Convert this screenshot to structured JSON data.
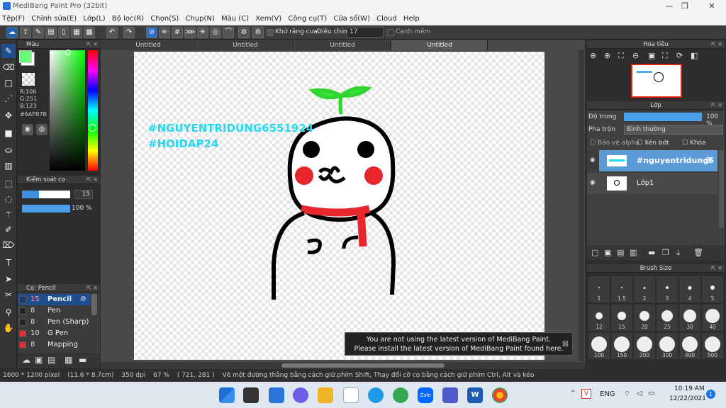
{
  "window": {
    "title": "MediBang Paint Pro (32bit)"
  },
  "menu": [
    "Tệp(F)",
    "Chỉnh sửa(E)",
    "Lớp(L)",
    "Bộ lọc(R)",
    "Chọn(S)",
    "Chụp(N)",
    "Màu (C)",
    "Xem(V)",
    "Công cụ(T)",
    "Cửa sổ(W)",
    "Cloud",
    "Help"
  ],
  "toolbar": {
    "antialias_label": "Khử răng cưa",
    "correction_label": "Điều chỉnh",
    "correction_value": "17",
    "snap_label": "Cạnh mềm"
  },
  "tabs": [
    "Untitled",
    "Untitled",
    "Untitled",
    "Untitled"
  ],
  "color_panel": {
    "title": "Màu",
    "r": "R:106",
    "g": "G:251",
    "b": "B:123",
    "hex": "#6AFB7B",
    "fg_color": "#6afb7b"
  },
  "brush_control": {
    "title": "Kiểm soát cọ",
    "size": "15",
    "opacity": "100 %"
  },
  "brush_list": {
    "title": "Cọ: Pencil",
    "items": [
      {
        "size": "15",
        "name": "Pencil",
        "color": "#1a3b6b"
      },
      {
        "size": "8",
        "name": "Pen",
        "color": "#222222"
      },
      {
        "size": "8",
        "name": "Pen (Sharp)",
        "color": "#222222"
      },
      {
        "size": "10",
        "name": "G Pen",
        "color": "#e03030"
      },
      {
        "size": "8",
        "name": "Mapping Pen",
        "color": "#e03030"
      }
    ]
  },
  "navigator": {
    "title": "Hoa tiêu"
  },
  "layer_panel": {
    "title": "Lớp",
    "opacity_label": "Độ trong",
    "opacity_value": "100 %",
    "blend_label": "Pha trộn",
    "blend_value": "Bình thường",
    "protect_alpha": "Bảo vệ alpha",
    "clipping": "Xén bớt",
    "lock": "Khóa",
    "layers": [
      {
        "name": "#nguyentridung6",
        "selected": true
      },
      {
        "name": "Lớp1",
        "selected": false
      }
    ]
  },
  "brush_size": {
    "title": "Brush Size",
    "sizes": [
      "1",
      "1.5",
      "2",
      "3",
      "4",
      "5",
      "12",
      "15",
      "20",
      "25",
      "30",
      "40",
      "100",
      "150",
      "200",
      "300",
      "400",
      "500"
    ]
  },
  "canvas_text": {
    "line1": "#NGUYENTRIDUNG6551924",
    "line2": "#HOIDAP24"
  },
  "notice": {
    "line1": "You are not using the latest version of MediBang Paint.",
    "line2": "Please install the latest version of MediBang Paint found here."
  },
  "status": {
    "size": "1600 * 1200 pixel",
    "cm": "(11.6 * 8.7cm)",
    "dpi": "350 dpi",
    "zoom": "67 %",
    "coords": "( 721, 281 )",
    "hint": "Vẽ một đường thẳng bằng cách giữ phím Shift, Thay đổi cỡ cọ bằng cách giữ phím Ctrl, Alt và kéo"
  },
  "taskbar": {
    "lang": "ENG",
    "time": "10:19 AM",
    "date": "12/22/2021",
    "badge": "1"
  }
}
